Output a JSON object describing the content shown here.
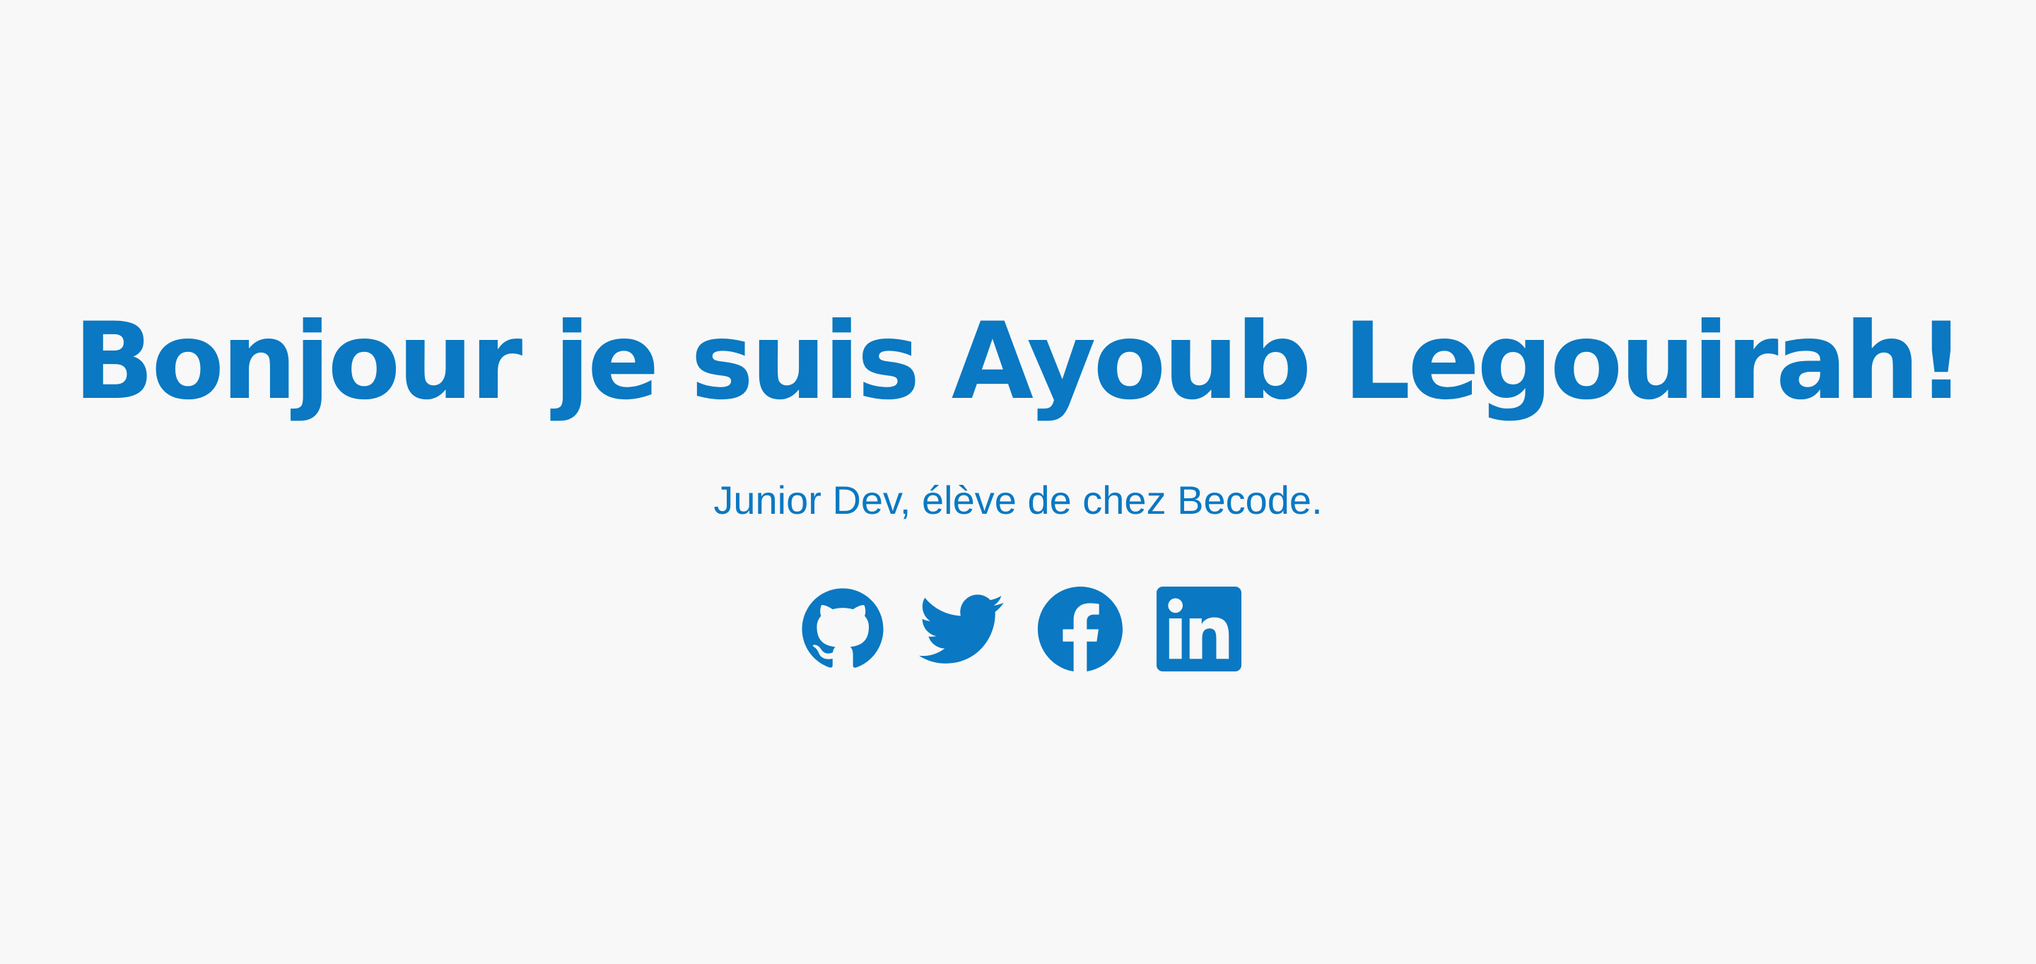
{
  "hero": {
    "headline": "Bonjour je suis Ayoub Legouirah!",
    "subtitle": "Junior Dev, élève de chez Becode."
  },
  "socials": [
    {
      "name": "GitHub",
      "icon": "github-icon"
    },
    {
      "name": "Twitter",
      "icon": "twitter-icon"
    },
    {
      "name": "Facebook",
      "icon": "facebook-icon"
    },
    {
      "name": "LinkedIn",
      "icon": "linkedin-icon"
    }
  ],
  "colors": {
    "accent": "#0a78c2",
    "background": "#f8f8f8"
  }
}
